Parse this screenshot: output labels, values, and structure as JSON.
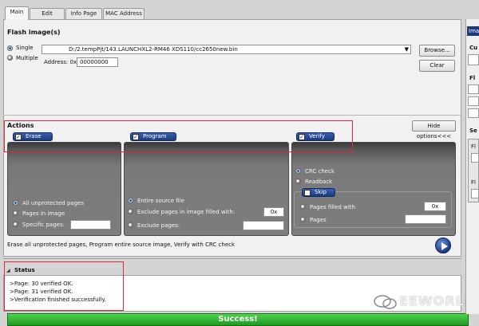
{
  "tabs": [
    {
      "label": "Main",
      "active": true
    },
    {
      "label": "Edit",
      "active": false
    },
    {
      "label": "Info Page",
      "active": false
    },
    {
      "label": "MAC Address",
      "active": false
    }
  ],
  "flash": {
    "title": "Flash image(s)",
    "mode_single": "Single",
    "mode_multiple": "Multiple",
    "selected_mode": "Single",
    "image_path": "D:/2.tempPjt/143.LAUNCHXL2-RM46 XDS110/cc2650new.bin",
    "address_label": "Address: 0x",
    "address_value": "00000000",
    "browse_label": "Browse...",
    "clear_label": "Clear"
  },
  "actions": {
    "title": "Actions",
    "hide_options_label": "Hide options<<<",
    "erase": {
      "label": "Erase",
      "checked": true,
      "options": [
        "All unprotected pages",
        "Pages in image",
        "Specific pages:"
      ],
      "selected": "All unprotected pages",
      "specific_pages_value": ""
    },
    "program": {
      "label": "Program",
      "checked": true,
      "options": [
        "Entire source file",
        "Exclude pages in image filled with:",
        "Exclude pages:"
      ],
      "selected": "Entire source file",
      "fill_value": "0x",
      "exclude_pages_value": ""
    },
    "verify": {
      "label": "Verify",
      "checked": true,
      "options": [
        "CRC check",
        "Readback"
      ],
      "selected": "CRC check",
      "skip": {
        "label": "Skip",
        "checked": false,
        "options": [
          "Pages filled with",
          "Pages"
        ],
        "fill_value": "0x",
        "pages_value": ""
      }
    },
    "summary": "Erase all unprotected pages, Program entire source image, Verify with CRC check"
  },
  "status": {
    "title": "Status",
    "lines": [
      ">Page: 30 verified OK.",
      ">Page: 31 verified OK.",
      ">Verification finished successfully."
    ],
    "result": "Success!"
  },
  "right_panel": {
    "tab_fragment": "Imag",
    "labels": [
      "Cu",
      "Fl",
      "Se",
      "Fl",
      "Fl"
    ]
  },
  "watermark": "EEWORLD",
  "colors": {
    "accent_blue": "#1c3a80",
    "highlight_red": "#e0283a",
    "success_green": "#1f9a1f"
  }
}
